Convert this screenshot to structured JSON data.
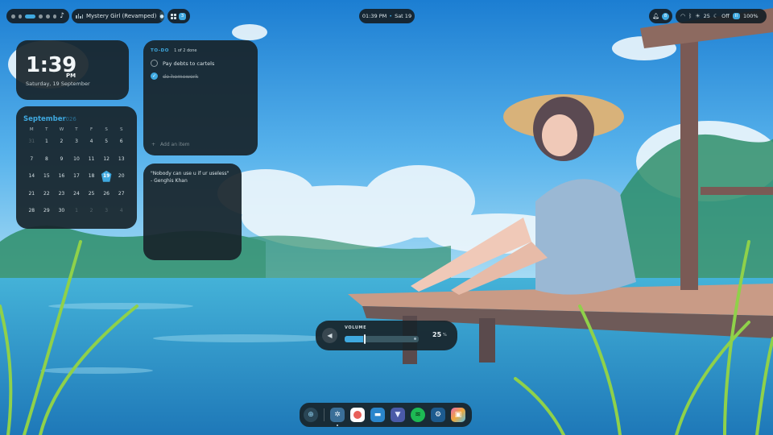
{
  "colors": {
    "accent": "#3fa9e0",
    "panel": "#18242a",
    "sky": "#3a9ad8",
    "water": "#2fa0c8"
  },
  "topbar": {
    "workspaces": {
      "count": 6,
      "active_index": 2,
      "icon": "music-note-icon"
    },
    "media": {
      "title": "Mystery Girl (Revamped)",
      "icon": "audio-bars-icon"
    },
    "apps_badge": "3",
    "clock": {
      "time": "01:39 PM",
      "separator": "•",
      "date": "Sat 19"
    },
    "notifications": {
      "icon": "bell-icon",
      "badge": "8"
    },
    "status": {
      "brightness": "25",
      "dnd": "Off",
      "battery_chip": "II",
      "battery": "100%"
    }
  },
  "clock_widget": {
    "time": "1:39",
    "ampm": "PM",
    "date": "Saturday, 19 September"
  },
  "calendar": {
    "month": "September",
    "year": "2026",
    "weekdays": [
      "M",
      "T",
      "W",
      "T",
      "F",
      "S",
      "S"
    ],
    "days": [
      [
        "31",
        "1",
        "2",
        "3",
        "4",
        "5",
        "6"
      ],
      [
        "7",
        "8",
        "9",
        "10",
        "11",
        "12",
        "13"
      ],
      [
        "14",
        "15",
        "16",
        "17",
        "18",
        "19",
        "20"
      ],
      [
        "21",
        "22",
        "23",
        "24",
        "25",
        "26",
        "27"
      ],
      [
        "28",
        "29",
        "30",
        "1",
        "2",
        "3",
        "4"
      ]
    ],
    "today": "19"
  },
  "todo": {
    "title": "TO-DO",
    "count": "1 of 2 done",
    "items": [
      {
        "text": "Pay debts to cartels",
        "done": false
      },
      {
        "text": "do homework",
        "done": true
      }
    ],
    "add_label": "Add an item"
  },
  "quote": {
    "text": "\"Nobody can use u if ur useless\"\n- Genghis Khan"
  },
  "volume": {
    "label": "VOLUME",
    "value": "25",
    "unit": "%",
    "level": 0.25
  },
  "dock": {
    "apps": [
      {
        "name": "launcher",
        "icon": "search-icon"
      },
      {
        "name": "settings",
        "icon": "gear-icon"
      },
      {
        "name": "record",
        "icon": "record-icon"
      },
      {
        "name": "files",
        "icon": "folder-icon"
      },
      {
        "name": "proton-vpn",
        "icon": "shield-icon"
      },
      {
        "name": "spotify",
        "icon": "spotify-icon"
      },
      {
        "name": "steam",
        "icon": "steam-icon"
      },
      {
        "name": "photos",
        "icon": "picture-icon"
      }
    ]
  }
}
